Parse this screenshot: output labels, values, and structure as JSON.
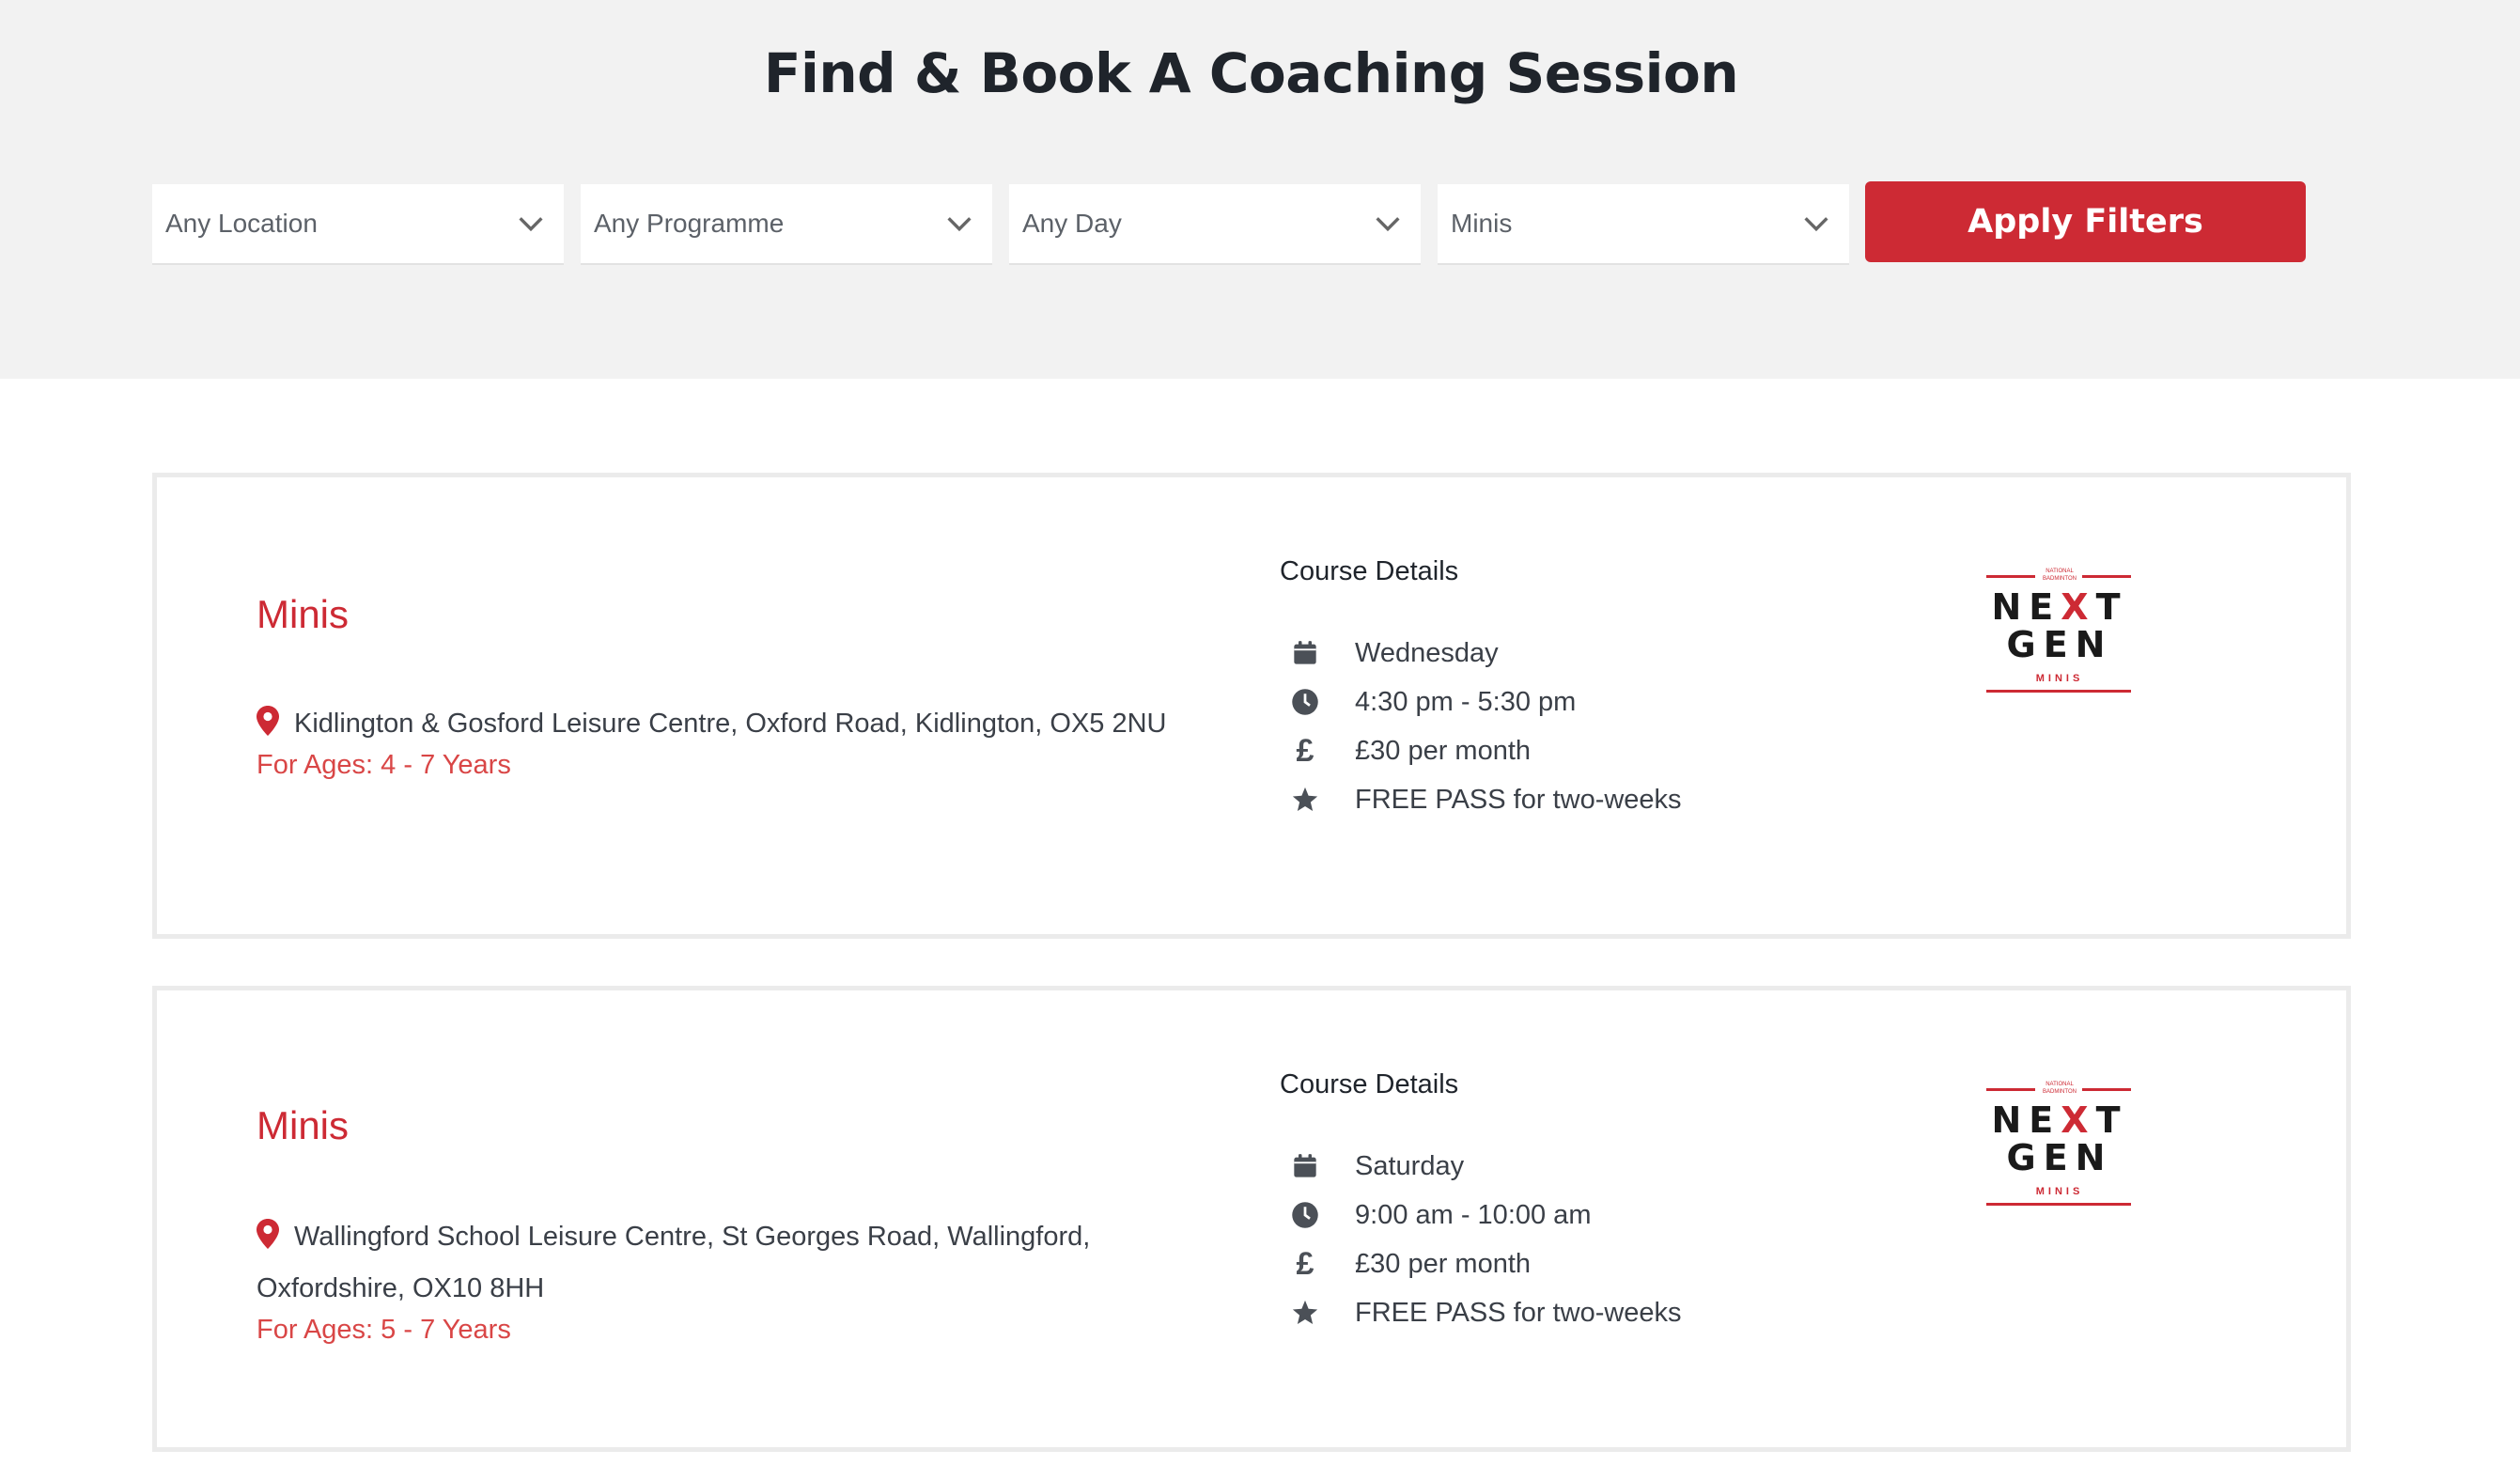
{
  "header": {
    "title": "Find & Book A Coaching Session"
  },
  "filters": {
    "location": "Any Location",
    "programme": "Any Programme",
    "day": "Any Day",
    "type": "Minis",
    "apply_label": "Apply Filters"
  },
  "colors": {
    "accent": "#cd2a34",
    "hero_bg": "#f2f2f2"
  },
  "details_label": "Course Details",
  "logo": {
    "line1": "NEXT",
    "line2": "GEN",
    "sub": "MINIS",
    "crest": "NATIONAL BADMINTON"
  },
  "sessions": [
    {
      "title": "Minis",
      "address": "Kidlington & Gosford Leisure Centre, Oxford Road, Kidlington, OX5 2NU",
      "ages": "For Ages: 4 - 7 Years",
      "day": "Wednesday",
      "time": "4:30 pm - 5:30 pm",
      "price": "£30 per month",
      "offer": "FREE PASS for two-weeks"
    },
    {
      "title": "Minis",
      "address": "Wallingford School Leisure Centre, St Georges Road, Wallingford, Oxfordshire, OX10 8HH",
      "ages": "For Ages: 5 - 7 Years",
      "day": "Saturday",
      "time": "9:00 am - 10:00 am",
      "price": "£30 per month",
      "offer": "FREE PASS for two-weeks"
    }
  ]
}
